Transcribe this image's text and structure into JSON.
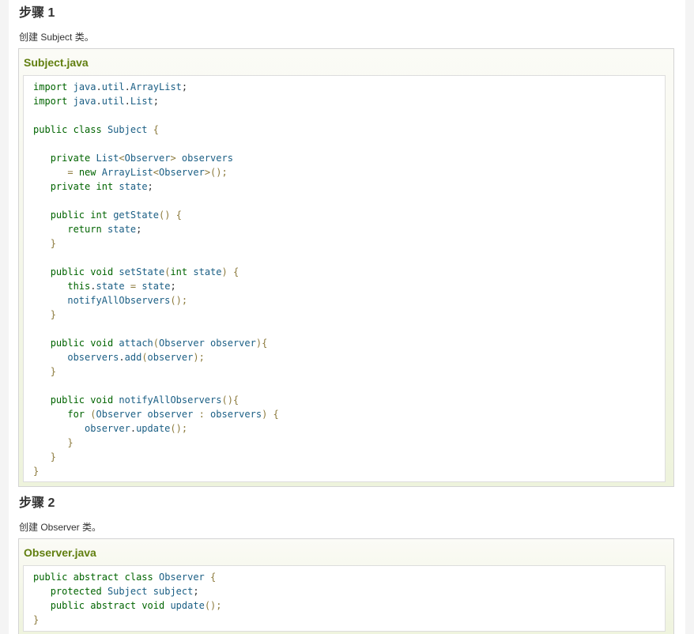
{
  "steps": [
    {
      "title": "步骤 1",
      "description": "创建 Subject 类。",
      "file_name": "Subject.java",
      "code": [
        "import java.util.ArrayList;",
        "import java.util.List;",
        "",
        "public class Subject {",
        "",
        "   private List<Observer> observers",
        "      = new ArrayList<Observer>();",
        "   private int state;",
        "",
        "   public int getState() {",
        "      return state;",
        "   }",
        "",
        "   public void setState(int state) {",
        "      this.state = state;",
        "      notifyAllObservers();",
        "   }",
        "",
        "   public void attach(Observer observer){",
        "      observers.add(observer);",
        "   }",
        "",
        "   public void notifyAllObservers(){",
        "      for (Observer observer : observers) {",
        "         observer.update();",
        "      }",
        "   }",
        "}"
      ]
    },
    {
      "title": "步骤 2",
      "description": "创建 Observer 类。",
      "file_name": "Observer.java",
      "code": [
        "public abstract class Observer {",
        "   protected Subject subject;",
        "   public abstract void update();",
        "}"
      ]
    }
  ],
  "colors": {
    "file_title": "#617f10",
    "keyword": "#006400",
    "identifier": "#1a5e84",
    "punctuation": "#8c7a3c"
  }
}
